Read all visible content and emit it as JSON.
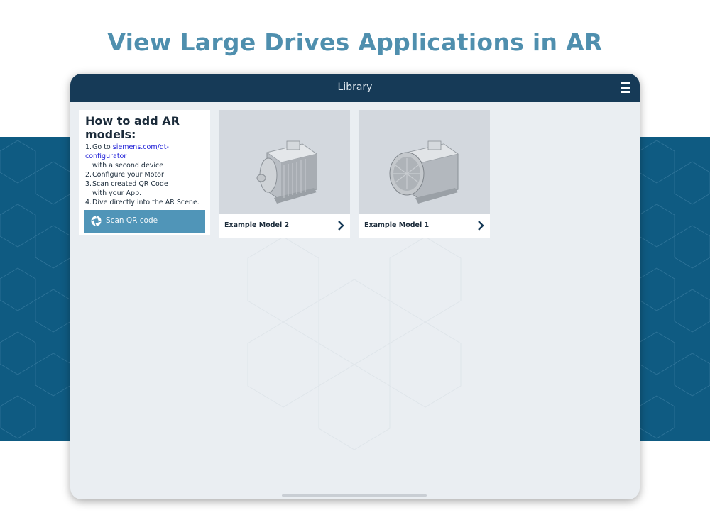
{
  "headline": "View Large Drives Applications in AR",
  "app": {
    "title": "Library",
    "menu_icon": "hamburger-menu-icon"
  },
  "howto": {
    "title": "How to add AR models:",
    "steps": [
      {
        "num": "1.",
        "text_before": "Go to ",
        "link": "siemens.com/dt-configurator",
        "cont": "with a second device"
      },
      {
        "num": "2.",
        "text": "Configure your Motor"
      },
      {
        "num": "3.",
        "text": "Scan created QR Code",
        "cont": "with your App."
      },
      {
        "num": "4.",
        "text": "Dive directly into the AR Scene."
      }
    ],
    "scan_button": {
      "label": "Scan QR code",
      "icon": "camera-shutter-icon"
    }
  },
  "models": [
    {
      "label": "Example Model 2",
      "icon": "chevron-right-icon"
    },
    {
      "label": "Example Model 1",
      "icon": "chevron-right-icon"
    }
  ],
  "colors": {
    "headline": "#4f8fae",
    "topbar": "#163a57",
    "band": "#0f5b82",
    "scan_button": "#5095b8",
    "link": "#1a1ad6"
  }
}
